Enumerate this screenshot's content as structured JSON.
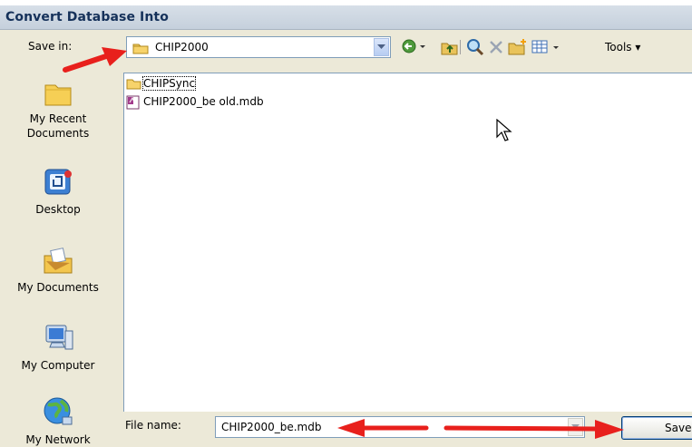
{
  "window": {
    "title": "Convert Database Into"
  },
  "save_in": {
    "label": "Save in:",
    "folder": "CHIP2000"
  },
  "toolbar": {
    "tools_label": "Tools"
  },
  "places": [
    {
      "label": "My Recent Documents",
      "icon": "recent-documents-icon"
    },
    {
      "label": "Desktop",
      "icon": "desktop-icon"
    },
    {
      "label": "My Documents",
      "icon": "my-documents-icon"
    },
    {
      "label": "My Computer",
      "icon": "my-computer-icon"
    },
    {
      "label": "My Network",
      "icon": "my-network-icon"
    }
  ],
  "files": [
    {
      "name": "CHIPSync",
      "type": "folder"
    },
    {
      "name": "CHIP2000_be old.mdb",
      "type": "access-database"
    }
  ],
  "file_name": {
    "label": "File name:",
    "value": "CHIP2000_be.mdb"
  },
  "save_button": {
    "label": "Save"
  },
  "colors": {
    "arrow": "#e8201c",
    "accent": "#15315a",
    "dialog_bg": "#ece9d8"
  }
}
